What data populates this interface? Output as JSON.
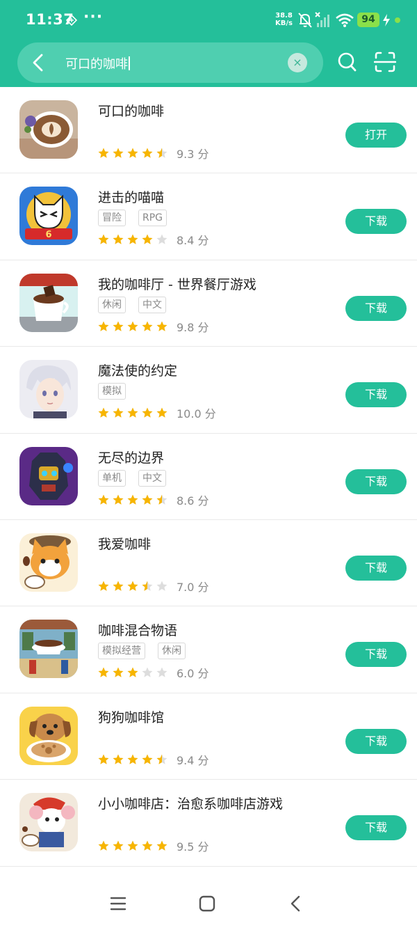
{
  "status_bar": {
    "time": "11:37",
    "more_dots": "···",
    "net_speed_value": "38.8",
    "net_speed_unit": "KB/s",
    "battery": "94",
    "icons": [
      "bridge-icon",
      "mute-bell-icon",
      "signal-icon",
      "wifi-icon",
      "charging-icon"
    ]
  },
  "search": {
    "query": "可口的咖啡",
    "clear_symbol": "×"
  },
  "colors": {
    "brand": "#24bf9a",
    "star": "#f7b500",
    "star_empty": "#dddddd"
  },
  "apps": [
    {
      "name": "可口的咖啡",
      "tags": [],
      "stars": 4.5,
      "score": "9.3 分",
      "action": "打开"
    },
    {
      "name": "进击的喵喵",
      "tags": [
        "冒险",
        "RPG"
      ],
      "stars": 4,
      "score": "8.4 分",
      "action": "下载"
    },
    {
      "name": "我的咖啡厅 - 世界餐厅游戏",
      "tags": [
        "休闲",
        "中文"
      ],
      "stars": 5,
      "score": "9.8 分",
      "action": "下载"
    },
    {
      "name": "魔法使的约定",
      "tags": [
        "模拟"
      ],
      "stars": 5,
      "score": "10.0 分",
      "action": "下载"
    },
    {
      "name": "无尽的边界",
      "tags": [
        "单机",
        "中文"
      ],
      "stars": 4.5,
      "score": "8.6 分",
      "action": "下载"
    },
    {
      "name": "我爱咖啡",
      "tags": [],
      "stars": 3.5,
      "score": "7.0 分",
      "action": "下载"
    },
    {
      "name": "咖啡混合物语",
      "tags": [
        "模拟经营",
        "休闲"
      ],
      "stars": 3,
      "score": "6.0 分",
      "action": "下载"
    },
    {
      "name": "狗狗咖啡馆",
      "tags": [],
      "stars": 4.5,
      "score": "9.4 分",
      "action": "下载"
    },
    {
      "name": "小小咖啡店：治愈系咖啡店游戏",
      "tags": [],
      "stars": 5,
      "score": "9.5 分",
      "action": "下载"
    }
  ],
  "nav": [
    "menu-icon",
    "home-icon",
    "back-icon"
  ]
}
